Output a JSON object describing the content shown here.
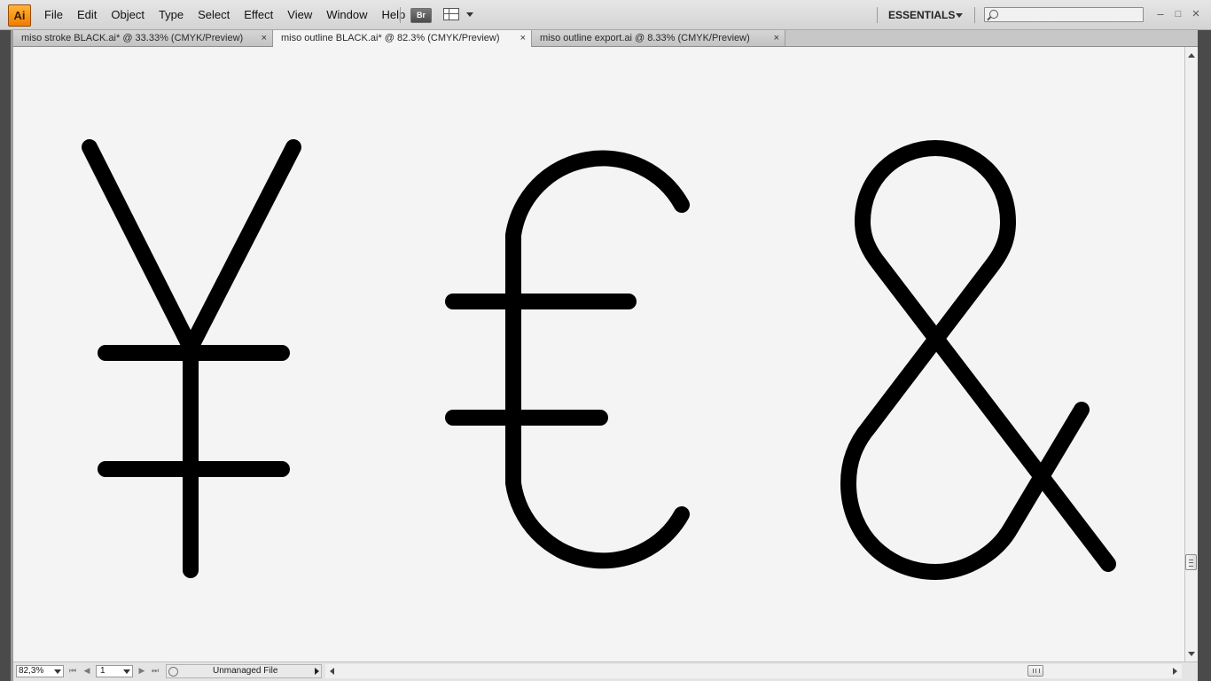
{
  "app": {
    "logo_text": "Ai"
  },
  "menu": {
    "items": [
      "File",
      "Edit",
      "Object",
      "Type",
      "Select",
      "Effect",
      "View",
      "Window",
      "Help"
    ],
    "bridge_label": "Br"
  },
  "workspace": {
    "label": "ESSENTIALS"
  },
  "search": {
    "placeholder": ""
  },
  "window_controls": {
    "minimize": "–",
    "maximize": "□",
    "close": "×"
  },
  "tabs": [
    {
      "label": "miso stroke BLACK.ai* @ 33.33% (CMYK/Preview)",
      "active": false
    },
    {
      "label": "miso outline BLACK.ai* @ 82.3% (CMYK/Preview)",
      "active": true
    },
    {
      "label": "miso outline export.ai @ 8.33% (CMYK/Preview)",
      "active": false
    }
  ],
  "tab_close_glyph": "×",
  "canvas": {
    "background": "#f4f4f4",
    "glyphs": [
      {
        "name": "yen-sign",
        "character": "¥"
      },
      {
        "name": "pound-sign",
        "character": "£"
      },
      {
        "name": "ampersand",
        "character": "&"
      }
    ],
    "glyph_color": "#000000"
  },
  "statusbar": {
    "zoom": "82,3%",
    "artboard": "1",
    "status": "Unmanaged File"
  }
}
